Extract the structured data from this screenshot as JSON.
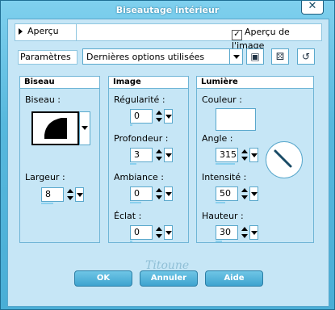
{
  "window": {
    "title": "Biseautage intérieur"
  },
  "preview": {
    "label": "Aperçu",
    "checkbox_label": "Aperçu de l'image",
    "checkbox_checked": true
  },
  "params": {
    "label": "Paramètres",
    "preset": "Dernières options utilisées"
  },
  "bevel": {
    "title": "Biseau",
    "bevel_label": "Biseau :",
    "width_label": "Largeur :",
    "width_value": "8"
  },
  "image": {
    "title": "Image",
    "smoothness_label": "Régularité :",
    "smoothness_value": "0",
    "depth_label": "Profondeur :",
    "depth_value": "3",
    "ambience_label": "Ambiance :",
    "ambience_value": "0",
    "shininess_label": "Éclat :",
    "shininess_value": "0"
  },
  "light": {
    "title": "Lumière",
    "color_label": "Couleur :",
    "color_value": "#ffffff",
    "angle_label": "Angle :",
    "angle_value": "315",
    "intensity_label": "Intensité :",
    "intensity_value": "50",
    "height_label": "Hauteur :",
    "height_value": "30"
  },
  "watermark": "Titoune",
  "buttons": {
    "ok": "OK",
    "cancel": "Annuler",
    "help": "Aide"
  },
  "colors": {
    "accent": "#4aaed6",
    "panel": "#c6e6f6"
  }
}
